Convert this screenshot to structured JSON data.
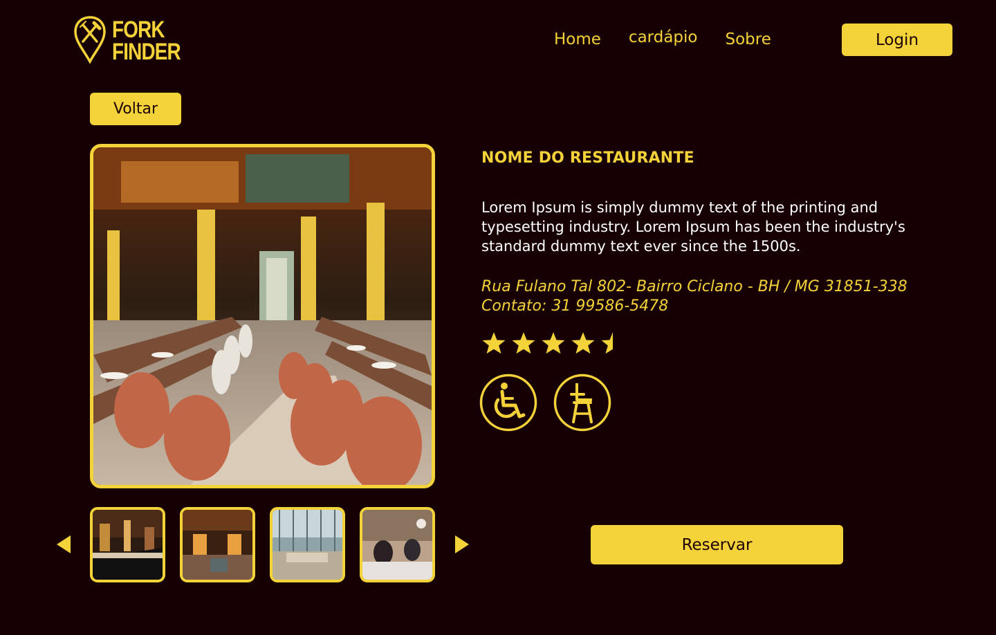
{
  "brand": {
    "line1": "FORK",
    "line2": "FINDER",
    "icon": "fork-knife-pin-icon"
  },
  "nav": {
    "items": [
      "Home",
      "cardápio",
      "Sobre"
    ]
  },
  "header": {
    "login_label": "Login"
  },
  "page": {
    "back_label": "Voltar"
  },
  "restaurant": {
    "name": "NOME DO RESTAURANTE",
    "description": "Lorem Ipsum is simply dummy text of the printing and typesetting industry. Lorem Ipsum has been the industry's standard dummy text ever since the 1500s.",
    "address": "Rua Fulano Tal 802- Bairro Ciclano - BH / MG 31851-338",
    "contact": "Contato: 31 99586-5478",
    "rating": 4.5,
    "rating_max": 5,
    "amenities": [
      "wheelchair-accessible-icon",
      "high-chair-icon"
    ]
  },
  "gallery": {
    "main_photo": "restaurant-interior-photo",
    "thumbnails": [
      "bar-counter-photo",
      "dining-hall-photo",
      "atrium-photo",
      "diners-photo"
    ]
  },
  "actions": {
    "reserve_label": "Reservar"
  },
  "colors": {
    "background": "#170003",
    "accent": "#f3d23a",
    "text": "#ffffff"
  }
}
